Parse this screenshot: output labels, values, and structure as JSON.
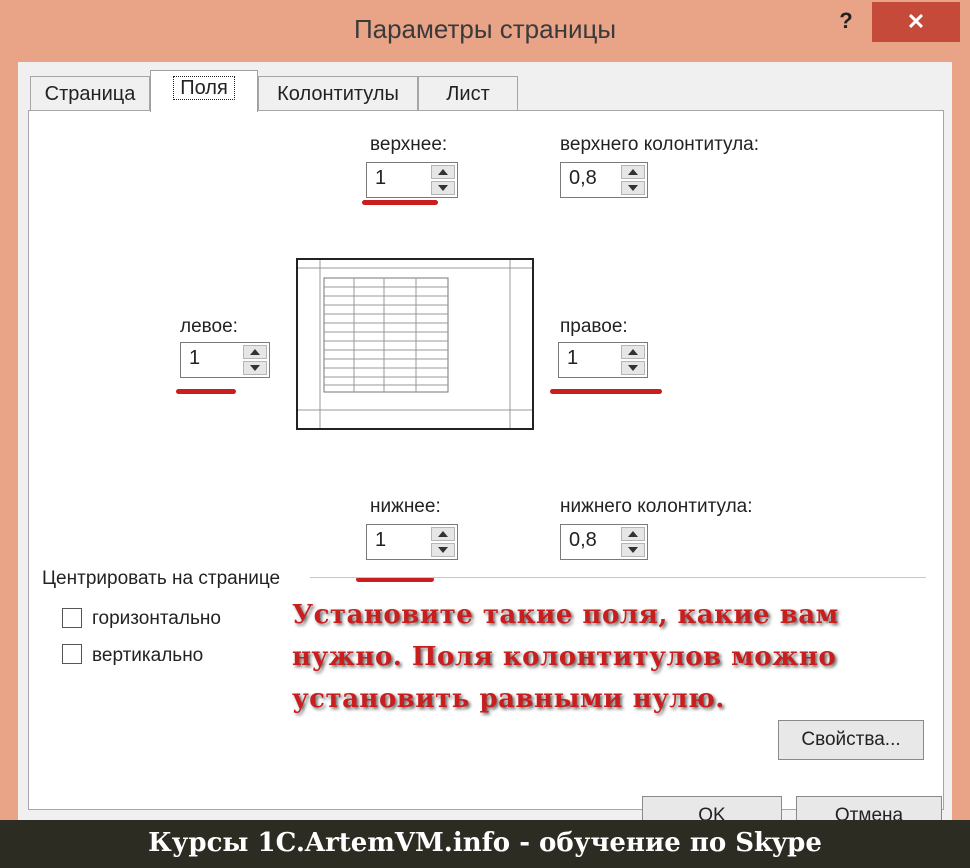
{
  "window": {
    "title": "Параметры страницы",
    "help_glyph": "?",
    "close_glyph": "✕"
  },
  "tabs": [
    {
      "label": "Страница"
    },
    {
      "label": "Поля"
    },
    {
      "label": "Колонтитулы"
    },
    {
      "label": "Лист"
    }
  ],
  "margins": {
    "top": {
      "label": "верхнее:",
      "value": "1"
    },
    "header": {
      "label": "верхнего колонтитула:",
      "value": "0,8"
    },
    "left": {
      "label": "левое:",
      "value": "1"
    },
    "right": {
      "label": "правое:",
      "value": "1"
    },
    "bottom": {
      "label": "нижнее:",
      "value": "1"
    },
    "footer": {
      "label": "нижнего колонтитула:",
      "value": "0,8"
    }
  },
  "center": {
    "heading": "Центрировать на странице",
    "horizontal": "горизонтально",
    "vertical": "вертикально"
  },
  "annotation": "Установите такие поля, какие вам нужно. Поля колонтитулов можно установить равными нулю.",
  "buttons": {
    "properties": "Свойства...",
    "ok": "OK",
    "cancel": "Отмена"
  },
  "footer_banner": "Курсы 1C.ArtemVM.info - обучение по Skype",
  "colors": {
    "title_bar": "#e9a487",
    "close_button": "#c64a3a",
    "annotation": "#c81e1e",
    "banner": "#2d2c22"
  }
}
